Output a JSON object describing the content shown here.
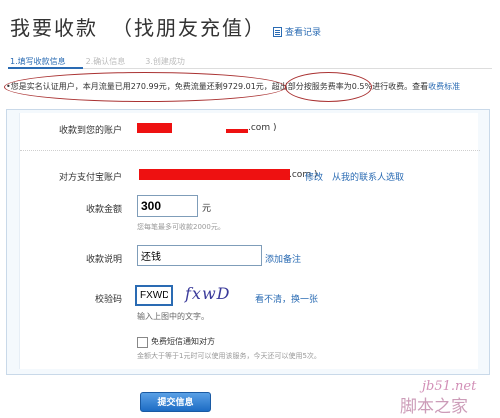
{
  "header": {
    "title": "我要收款",
    "subtitle": "（找朋友充值）",
    "records_link": "查看记录"
  },
  "steps": [
    "1.填写收款信息",
    "2.确认信息",
    "3.创建成功"
  ],
  "notice": {
    "text1": "•您是实名认证用户，本月流量已用270.99元，免费流量还剩9729.01元，",
    "text2": "超出部分按服务费率为0.5%",
    "text3": "进行收费。查看",
    "link": "收费标准"
  },
  "form": {
    "receive_account_label": "收款到您的账户",
    "receive_account_tail": ".com )",
    "payer_label": "对方支付宝账户",
    "payer_tail": ".com )",
    "payer_edit": "修改",
    "payer_choose": "从我的联系人选取",
    "amount_label": "收款金额",
    "amount_value": "300",
    "amount_unit": "元",
    "amount_hint": "您每笔最多可收款2000元。",
    "desc_label": "收款说明",
    "desc_value": "还钱",
    "desc_add": "添加备注",
    "captcha_label": "校验码",
    "captcha_value": "FXWD",
    "captcha_image_text": "fxwD",
    "captcha_refresh": "看不清，换一张",
    "captcha_hint": "输入上图中的文字。",
    "sms_label": "免费短信通知对方",
    "sms_hint": "金额大于等于1元时可以使用该服务，今天还可以使用5次。"
  },
  "submit": "提交信息",
  "watermark": {
    "site": "jb51.net",
    "name": "脚本之家"
  },
  "colors": {
    "link": "#2a6bb3",
    "redaction": "#ee1111",
    "button": "#1d6cc4",
    "annotation": "#a33333"
  }
}
